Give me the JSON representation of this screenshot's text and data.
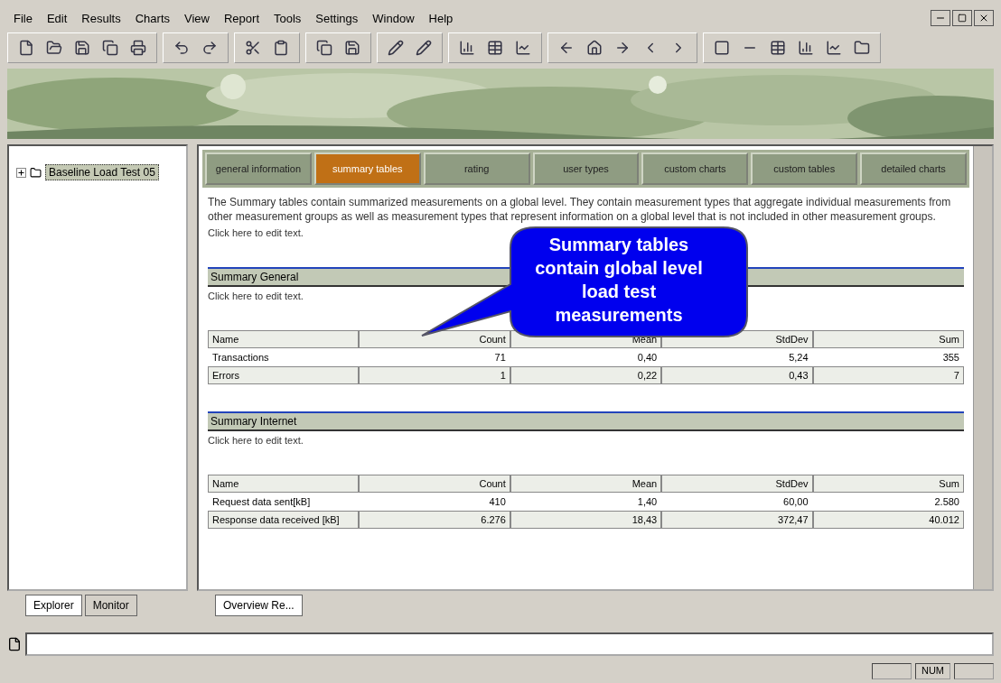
{
  "menu": [
    "File",
    "Edit",
    "Results",
    "Charts",
    "View",
    "Report",
    "Tools",
    "Settings",
    "Window",
    "Help"
  ],
  "tree": [
    {
      "label": "Baseline Load Test 05",
      "selected": true,
      "expanded": false
    }
  ],
  "report_tabs": [
    {
      "label": "general information",
      "selected": false
    },
    {
      "label": "summary tables",
      "selected": true
    },
    {
      "label": "rating",
      "selected": false
    },
    {
      "label": "user types",
      "selected": false
    },
    {
      "label": "custom charts",
      "selected": false
    },
    {
      "label": "custom tables",
      "selected": false
    },
    {
      "label": "detailed charts",
      "selected": false
    }
  ],
  "intro": "The Summary tables contain summarized measurements on a global level. They contain measurement types that aggregate individual measurements from other measurement groups as well as measurement types that represent information on a global level that is not included in other measurement groups.",
  "intro_edit": "Click here to edit text.",
  "callout": "Summary tables contain global level load test measurements",
  "sections": [
    {
      "title": "Summary General",
      "edit": "Click here to edit text.",
      "columns": [
        "Name",
        "Count",
        "Mean",
        "StdDev",
        "Sum"
      ],
      "rows": [
        [
          "Transactions",
          "71",
          "0,40",
          "5,24",
          "355"
        ],
        [
          "Errors",
          "1",
          "0,22",
          "0,43",
          "7"
        ]
      ]
    },
    {
      "title": "Summary Internet",
      "edit": "Click here to edit text.",
      "columns": [
        "Name",
        "Count",
        "Mean",
        "StdDev",
        "Sum"
      ],
      "rows": [
        [
          "Request data sent[kB]",
          "410",
          "1,40",
          "60,00",
          "2.580"
        ],
        [
          "Response data received [kB]",
          "6.276",
          "18,43",
          "372,47",
          "40.012"
        ]
      ]
    }
  ],
  "left_tabs": [
    {
      "label": "Explorer",
      "selected": true
    },
    {
      "label": "Monitor",
      "selected": false
    }
  ],
  "doc_tabs": [
    {
      "label": "Overview Re...",
      "selected": true
    }
  ],
  "status": "NUM"
}
